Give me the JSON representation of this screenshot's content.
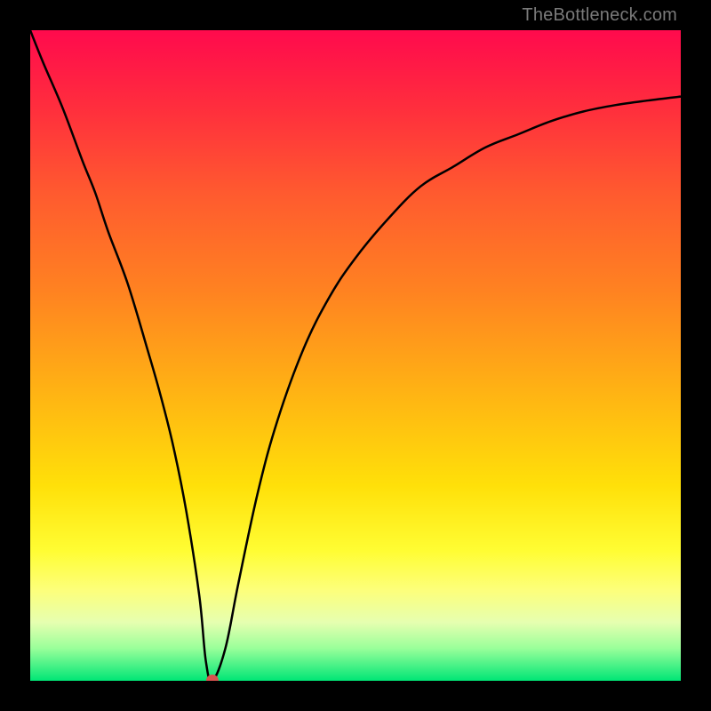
{
  "watermark": "TheBottleneck.com",
  "chart_data": {
    "type": "line",
    "title": "",
    "xlabel": "",
    "ylabel": "",
    "xlim": [
      0,
      100
    ],
    "ylim": [
      0,
      100
    ],
    "series": [
      {
        "name": "bottleneck-curve",
        "x": [
          0,
          2,
          5,
          8,
          10,
          12,
          15,
          18,
          20,
          22,
          24,
          26,
          27,
          28,
          30,
          32,
          35,
          38,
          42,
          46,
          50,
          55,
          60,
          65,
          70,
          75,
          80,
          85,
          90,
          95,
          100
        ],
        "values": [
          100,
          95,
          88,
          80,
          75,
          69,
          61,
          51,
          44,
          36,
          26,
          13,
          3,
          0,
          5,
          15,
          29,
          40,
          51,
          59,
          65,
          71,
          76,
          79,
          82,
          84,
          86,
          87.5,
          88.5,
          89.2,
          89.8
        ]
      }
    ],
    "minimum_point": {
      "x": 28,
      "y": 0
    },
    "background_gradient": {
      "top": "#ff0a4d",
      "mid_upper": "#ff8221",
      "mid_lower": "#ffe009",
      "bottom": "#00e676"
    }
  }
}
